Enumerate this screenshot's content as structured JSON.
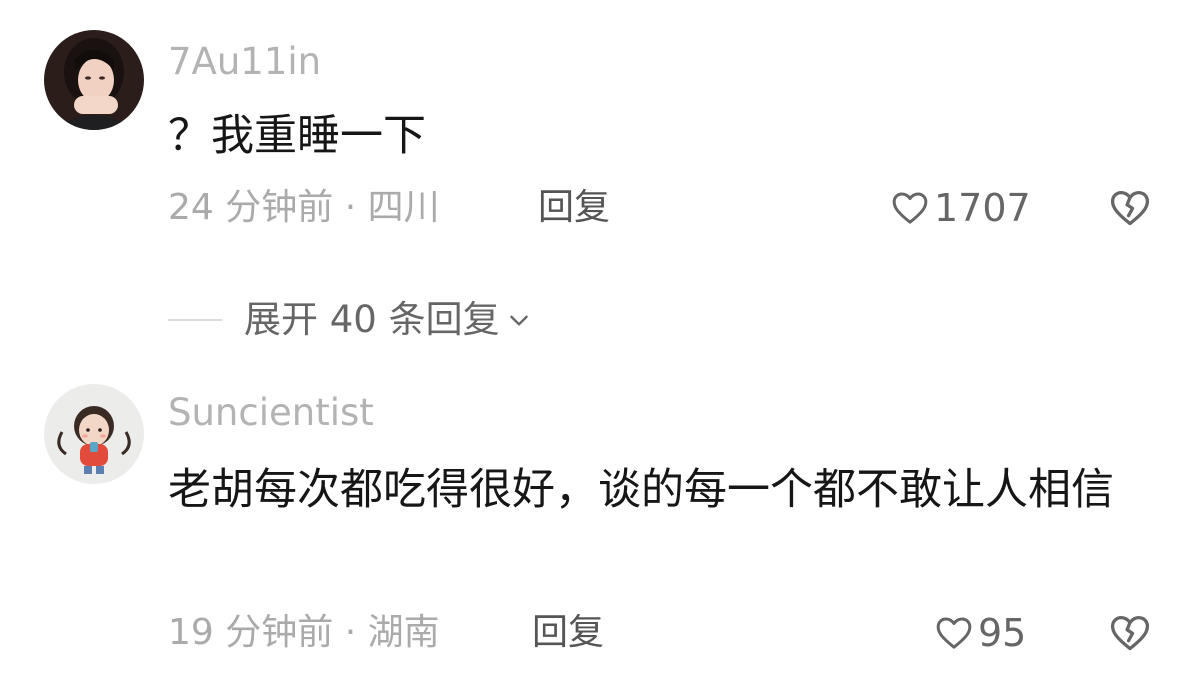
{
  "comments": [
    {
      "username": "7Au11in",
      "text": "？我重睡一下",
      "meta": "24 分钟前 · 四川",
      "reply_label": "回复",
      "likes": "1707",
      "avatar_icon": "user-avatar-girl-dark-hair"
    },
    {
      "username": "Suncientist",
      "text": "老胡每次都吃得很好，谈的每一个都不敢让人相信",
      "meta": "19 分钟前 · 湖南",
      "reply_label": "回复",
      "likes": "95",
      "avatar_icon": "user-avatar-cartoon-girl"
    }
  ],
  "expand": {
    "label": "展开 40 条回复"
  },
  "icons": {
    "like": "heart-outline-icon",
    "dislike": "broken-heart-icon",
    "expand": "chevron-down-icon"
  },
  "colors": {
    "username": "#b3b3b3",
    "meta": "#aaaaaa",
    "text": "#161616",
    "action": "#666666"
  }
}
